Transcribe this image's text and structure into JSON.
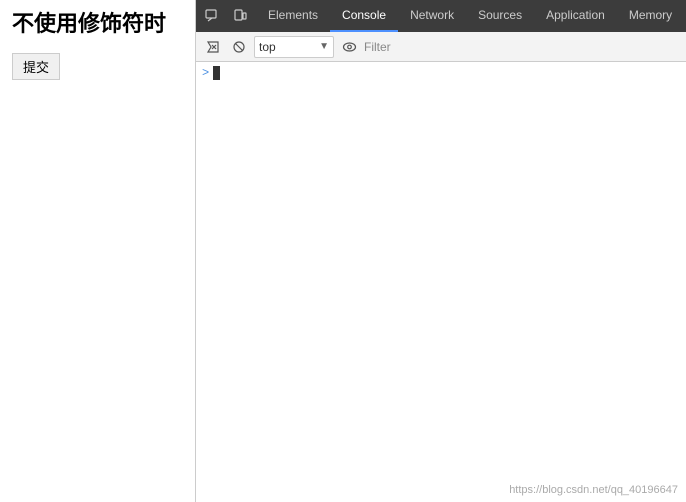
{
  "webpage": {
    "title": "不使用修饰符时",
    "submit_label": "提交"
  },
  "devtools": {
    "tabs": [
      {
        "id": "elements",
        "label": "Elements",
        "active": false
      },
      {
        "id": "console",
        "label": "Console",
        "active": true
      },
      {
        "id": "network",
        "label": "Network",
        "active": false
      },
      {
        "id": "sources",
        "label": "Sources",
        "active": false
      },
      {
        "id": "application",
        "label": "Application",
        "active": false
      },
      {
        "id": "memory",
        "label": "Memory",
        "active": false
      }
    ],
    "toolbar": {
      "context_selector_value": "top",
      "filter_placeholder": "Filter"
    },
    "console": {
      "prompt_arrow": ">"
    }
  },
  "watermark": {
    "text": "https://blog.csdn.net/qq_40196647"
  },
  "icons": {
    "inspect": "⬚",
    "device": "⊡",
    "clear": "🚫",
    "eye": "👁",
    "chevron_down": "▼"
  }
}
